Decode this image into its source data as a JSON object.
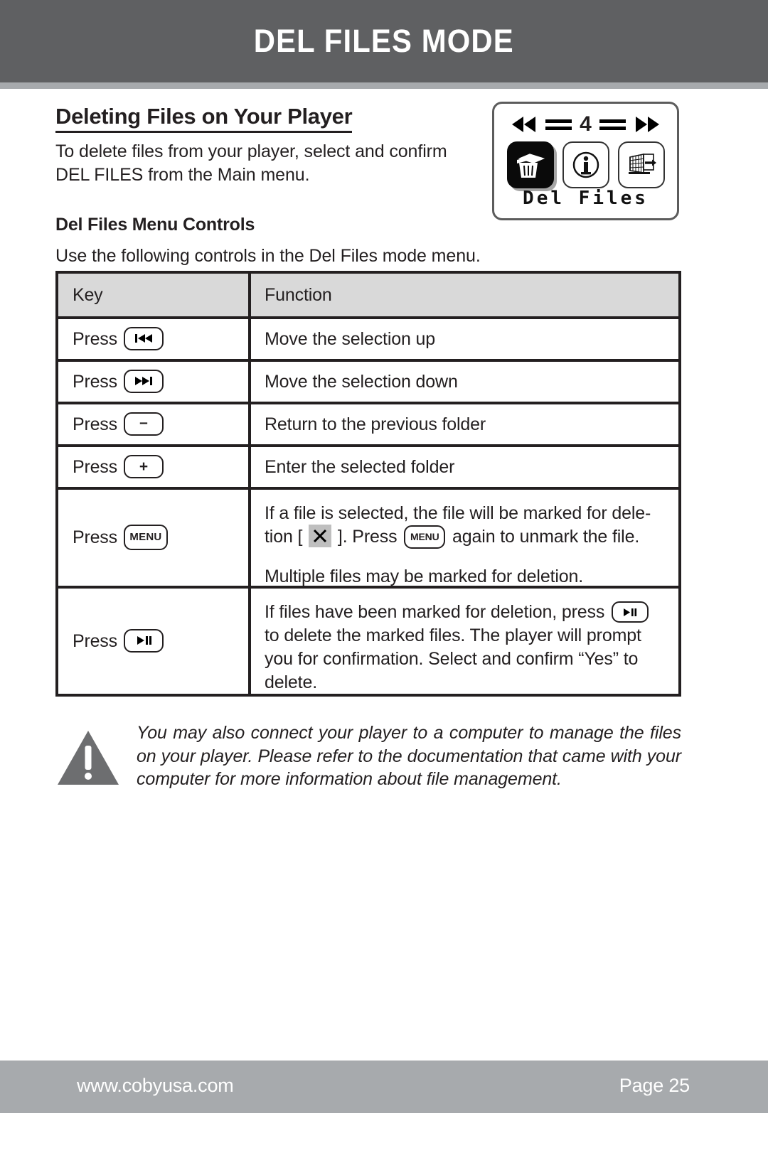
{
  "header": {
    "title": "DEL FILES MODE",
    "band_color": "#5f6062",
    "strip_color": "#a7aaad"
  },
  "section": {
    "title": "Deleting Files on Your Player",
    "intro": "To delete files from your player, select and confirm DEL FILES from the Main menu.",
    "sub_title": "Del Files Menu Controls",
    "sub_intro": "Use the following controls in the Del Files mode menu."
  },
  "lcd": {
    "prev_icon": "rewind-icon",
    "next_icon": "fast-forward-icon",
    "page_number": "4",
    "icons": [
      {
        "name": "trash-icon",
        "selected": true
      },
      {
        "name": "info-icon",
        "selected": false
      },
      {
        "name": "exit-icon",
        "selected": false
      }
    ],
    "label": "Del Files"
  },
  "table": {
    "columns": [
      "Key",
      "Function"
    ],
    "header_bg": "#d9d9d9",
    "rows": [
      {
        "press_label": "Press",
        "key_icon": "prev-track-icon",
        "function": "Move the selection up"
      },
      {
        "press_label": "Press",
        "key_icon": "next-track-icon",
        "function": "Move the selection down"
      },
      {
        "press_label": "Press",
        "key_icon": "minus-icon",
        "key_text": "–",
        "function": "Return to the previous folder"
      },
      {
        "press_label": "Press",
        "key_icon": "plus-icon",
        "key_text": "+",
        "function": "Enter the selected folder"
      },
      {
        "press_label": "Press",
        "key_icon": "menu-button-icon",
        "key_text": "MENU",
        "function_part1_a": "If a file is selected, the file will be marked for dele-",
        "function_part1_b": "tion [",
        "function_part1_c": "]. Press",
        "function_part1_d": "again to unmark the file.",
        "function_part2": "Multiple files may be marked for deletion.",
        "inline_menu_text": "MENU",
        "mark_symbol": "✕"
      },
      {
        "press_label": "Press",
        "key_icon": "play-pause-icon",
        "function_a": "If files have been marked for deletion, press",
        "function_b": "to delete the marked files. The player will prompt you for confirmation. Select and confirm “Yes” to delete."
      }
    ]
  },
  "note": {
    "icon": "warning-triangle-icon",
    "text": "You may also connect your player to a computer to manage the files on your player. Please refer to the documentation that came with your computer for more information about file management."
  },
  "footer": {
    "url": "www.cobyusa.com",
    "page": "Page 25",
    "band_color": "#a7aaad"
  }
}
